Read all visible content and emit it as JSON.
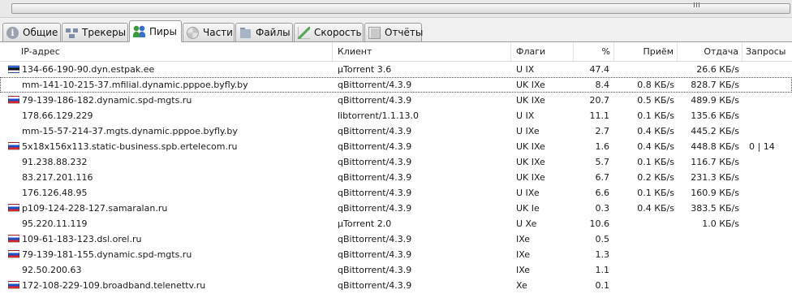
{
  "tabs": [
    {
      "label": "Общие",
      "icon": "info-icon",
      "active": false
    },
    {
      "label": "Трекеры",
      "icon": "trackers-icon",
      "active": false
    },
    {
      "label": "Пиры",
      "icon": "peers-icon",
      "active": true
    },
    {
      "label": "Части",
      "icon": "pieces-icon",
      "active": false
    },
    {
      "label": "Файлы",
      "icon": "files-icon",
      "active": false
    },
    {
      "label": "Скорость",
      "icon": "speed-graph-icon",
      "active": false
    },
    {
      "label": "Отчёты",
      "icon": "logger-icon",
      "active": false
    }
  ],
  "columns": {
    "ip": "IP-адрес",
    "client": "Клиент",
    "flags": "Флаги",
    "percent": "%",
    "down": "Приём",
    "up": "Отдача",
    "reqs": "Запросы"
  },
  "peers": [
    {
      "flag": "ee",
      "ip": "134-66-190-90.dyn.estpak.ee",
      "client": "µTorrent 3.6",
      "flags": "U IX",
      "percent": "47.4",
      "down": "",
      "up": "26.6 КБ/s",
      "reqs": ""
    },
    {
      "flag": "",
      "ip": "mm-141-10-215-37.mfilial.dynamic.pppoe.byfly.by",
      "client": "qBittorrent/4.3.9",
      "flags": "UK IXe",
      "percent": "8.4",
      "down": "0.8 КБ/s",
      "up": "828.7 КБ/s",
      "reqs": "",
      "focused": true
    },
    {
      "flag": "ru",
      "ip": "79-139-186-182.dynamic.spd-mgts.ru",
      "client": "qBittorrent/4.3.9",
      "flags": "UK IXe",
      "percent": "20.7",
      "down": "0.5 КБ/s",
      "up": "489.9 КБ/s",
      "reqs": ""
    },
    {
      "flag": "",
      "ip": "178.66.129.229",
      "client": "libtorrent/1.1.13.0",
      "flags": "U IX",
      "percent": "11.1",
      "down": "0.1 КБ/s",
      "up": "135.6 КБ/s",
      "reqs": ""
    },
    {
      "flag": "",
      "ip": "mm-15-57-214-37.mgts.dynamic.pppoe.byfly.by",
      "client": "qBittorrent/4.3.9",
      "flags": "U IXe",
      "percent": "2.7",
      "down": "0.4 КБ/s",
      "up": "445.2 КБ/s",
      "reqs": ""
    },
    {
      "flag": "ru",
      "ip": "5x18x156x113.static-business.spb.ertelecom.ru",
      "client": "qBittorrent/4.3.9",
      "flags": "UK IXe",
      "percent": "1.6",
      "down": "0.4 КБ/s",
      "up": "448.8 КБ/s",
      "reqs": "0 | 14"
    },
    {
      "flag": "",
      "ip": "91.238.88.232",
      "client": "qBittorrent/4.3.9",
      "flags": "UK IXe",
      "percent": "5.7",
      "down": "0.1 КБ/s",
      "up": "116.7 КБ/s",
      "reqs": ""
    },
    {
      "flag": "",
      "ip": "83.217.201.116",
      "client": "qBittorrent/4.3.9",
      "flags": "UK IXe",
      "percent": "6.7",
      "down": "0.2 КБ/s",
      "up": "231.3 КБ/s",
      "reqs": ""
    },
    {
      "flag": "",
      "ip": "176.126.48.95",
      "client": "qBittorrent/4.3.9",
      "flags": "U IXe",
      "percent": "6.6",
      "down": "0.1 КБ/s",
      "up": "160.9 КБ/s",
      "reqs": ""
    },
    {
      "flag": "ru",
      "ip": "p109-124-228-127.samaralan.ru",
      "client": "qBittorrent/4.3.9",
      "flags": "UK Ie",
      "percent": "0.3",
      "down": "0.4 КБ/s",
      "up": "383.5 КБ/s",
      "reqs": ""
    },
    {
      "flag": "",
      "ip": "95.220.11.119",
      "client": "µTorrent 2.0",
      "flags": "U Xe",
      "percent": "10.6",
      "down": "",
      "up": "1.0 КБ/s",
      "reqs": ""
    },
    {
      "flag": "ru",
      "ip": "109-61-183-123.dsl.orel.ru",
      "client": "qBittorrent/4.3.9",
      "flags": "IXe",
      "percent": "0.5",
      "down": "",
      "up": "",
      "reqs": ""
    },
    {
      "flag": "ru",
      "ip": "79-139-181-155.dynamic.spd-mgts.ru",
      "client": "qBittorrent/4.3.9",
      "flags": "IXe",
      "percent": "1.3",
      "down": "",
      "up": "",
      "reqs": ""
    },
    {
      "flag": "",
      "ip": "92.50.200.63",
      "client": "qBittorrent/4.3.9",
      "flags": "IXe",
      "percent": "1.1",
      "down": "",
      "up": "",
      "reqs": ""
    },
    {
      "flag": "ru",
      "ip": "172-108-229-109.broadband.telenettv.ru",
      "client": "qBittorrent/4.3.9",
      "flags": "Xe",
      "percent": "0.1",
      "down": "",
      "up": "",
      "reqs": ""
    }
  ]
}
